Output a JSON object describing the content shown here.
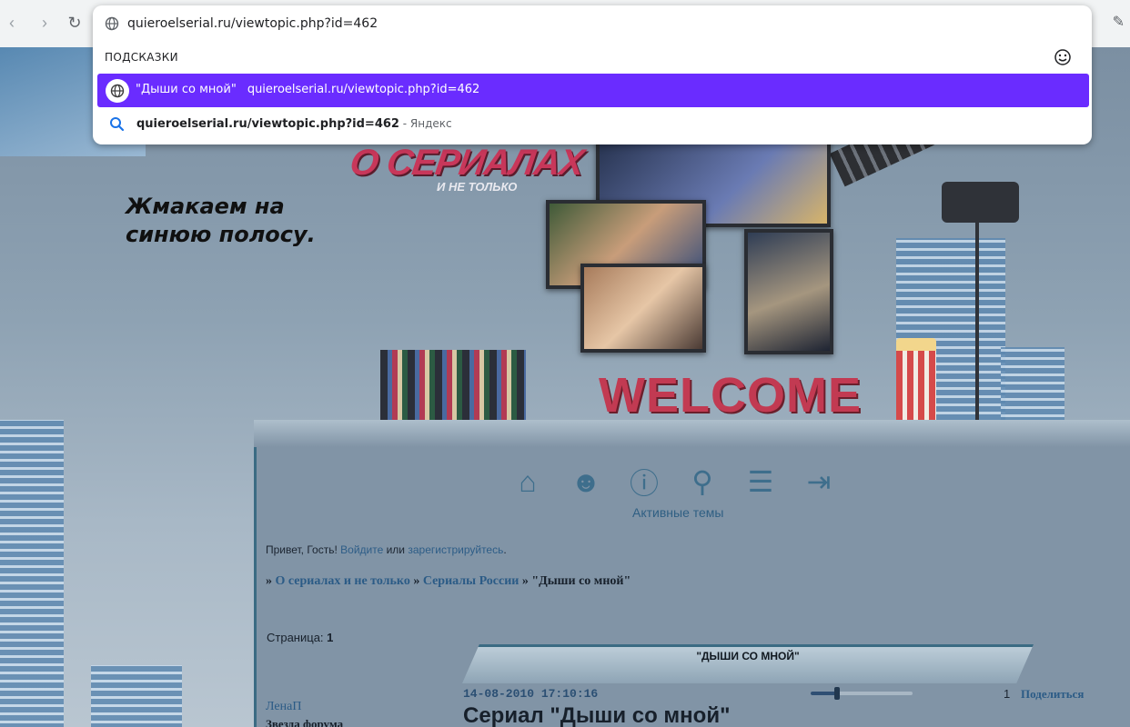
{
  "browser": {
    "url": "quieroelserial.ru/viewtopic.php?id=462",
    "back_glyph": "‹",
    "forward_glyph": "›",
    "reload_glyph": "↻",
    "edit_glyph": "✎"
  },
  "omnibox": {
    "section_label": "ПОДСКАЗКИ",
    "suggestions": [
      {
        "title": "\"Дыши со мной\"",
        "url": "quieroelserial.ru/viewtopic.php?id=462",
        "icon": "globe-icon",
        "highlighted": true
      },
      {
        "query": "quieroelserial.ru/viewtopic.php?id=462",
        "engine": " - Яндекс",
        "icon": "search-icon",
        "highlighted": false
      }
    ],
    "highlight_color": "#6a2cff"
  },
  "annotation": "Жмакаем на синюю полосу.",
  "header": {
    "logo_title": "О СЕРИАЛАХ",
    "logo_subtitle": "И НЕ ТОЛЬКО",
    "welcome": "WELCOME"
  },
  "forum": {
    "nav_icons": [
      {
        "name": "home-icon",
        "glyph": "⌂"
      },
      {
        "name": "users-icon",
        "glyph": "☻"
      },
      {
        "name": "rules-icon",
        "glyph": "ⓘ"
      },
      {
        "name": "search-icon",
        "glyph": "⚲"
      },
      {
        "name": "posts-icon",
        "glyph": "☰"
      },
      {
        "name": "login-icon",
        "glyph": "⇥"
      }
    ],
    "nav_caption": "Активные темы",
    "greeting": {
      "prefix": "Привет, Гость! ",
      "login_link": "Войдите",
      "middle": " или ",
      "register_link": "зарегистрируйтесь",
      "suffix": "."
    },
    "breadcrumbs": {
      "sep": "» ",
      "forum": "О сериалах и не только",
      "section": "Сериалы России",
      "topic": "\"Дыши со мной\""
    },
    "pager": {
      "label": "Страница:",
      "current": "1"
    },
    "topic_title": "\"ДЫШИ СО МНОЙ\"",
    "post": {
      "date": "14-08-2010 17:10:16",
      "number": "1",
      "share_label": "Поделиться",
      "author": "ЛенаП",
      "author_rank": "Звезда форума",
      "title": "Сериал \"Дыши со мной\"",
      "slider_fraction": 0.26
    }
  }
}
